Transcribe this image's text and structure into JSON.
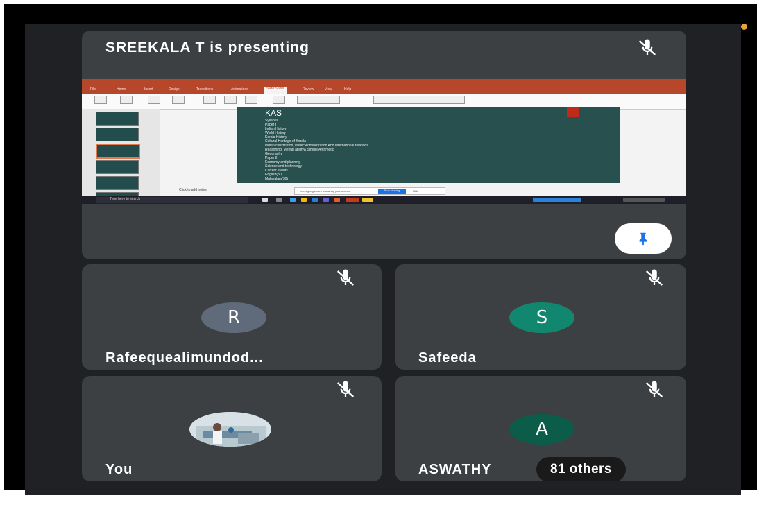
{
  "presenter": {
    "title": "SREEKALA T is presenting"
  },
  "shared_screen": {
    "ribbon_tabs": [
      "File",
      "Home",
      "Insert",
      "Design",
      "Transitions",
      "Animations",
      "Slide Show",
      "Review",
      "View",
      "Help"
    ],
    "active_tab": "Slide Show",
    "slide_title": "KAS",
    "slide_lines": [
      "Syllabus",
      "Paper I",
      "Indian History",
      "World History",
      "Kerala History",
      "Cultural Heritage of Kerala",
      "Indian constitution, Public Administration And International relations",
      "Reasoning, Mental ability& Simple Arithmetic",
      "Geography",
      "Paper II",
      "Economy and planning",
      "Science and technology",
      "Current events",
      "English(30)",
      "Malayalam(30)"
    ],
    "notes_placeholder": "Click to add notes",
    "share_notice": "meet.google.com is sharing your screen.",
    "stop_sharing": "Stop sharing",
    "hide": "Hide",
    "taskbar_search": "Type here to search"
  },
  "participants": [
    {
      "name": "Rafeequealimundod...",
      "initial": "R",
      "avatar_color": "#5f6b7a"
    },
    {
      "name": "Safeeda",
      "initial": "S",
      "avatar_color": "#12876f"
    },
    {
      "name": "You",
      "initial": "",
      "avatar_color": "#cfd8dc"
    },
    {
      "name": "ASWATHY",
      "initial": "A",
      "avatar_color": "#0b5c48"
    }
  ],
  "others_badge": "81 others",
  "icons": {
    "mic_off": "mic-off-icon",
    "pin": "pin-icon"
  },
  "colors": {
    "background": "#202124",
    "tile": "#3c4043",
    "pin_blue": "#1a73e8"
  }
}
